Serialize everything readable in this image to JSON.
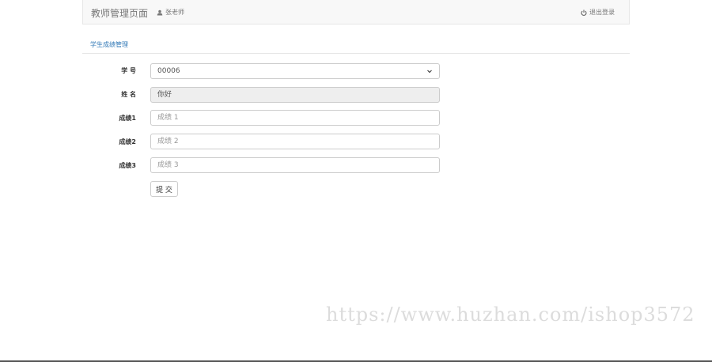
{
  "navbar": {
    "brand": "教师管理页面",
    "user_name": "张老师",
    "logout_label": "退出登录"
  },
  "section": {
    "title": "学生成绩管理"
  },
  "form": {
    "student_id_label": "学 号",
    "student_id_value": "00006",
    "name_label": "姓 名",
    "name_value": "你好",
    "score1_label": "成绩1",
    "score1_placeholder": "成绩 1",
    "score2_label": "成绩2",
    "score2_placeholder": "成绩 2",
    "score3_label": "成绩3",
    "score3_placeholder": "成绩 3",
    "submit_label": "提 交"
  },
  "watermark": "https://www.huzhan.com/ishop3572",
  "icons": {
    "user": "user-icon",
    "power": "power-icon",
    "caret": "chevron-down-icon"
  }
}
